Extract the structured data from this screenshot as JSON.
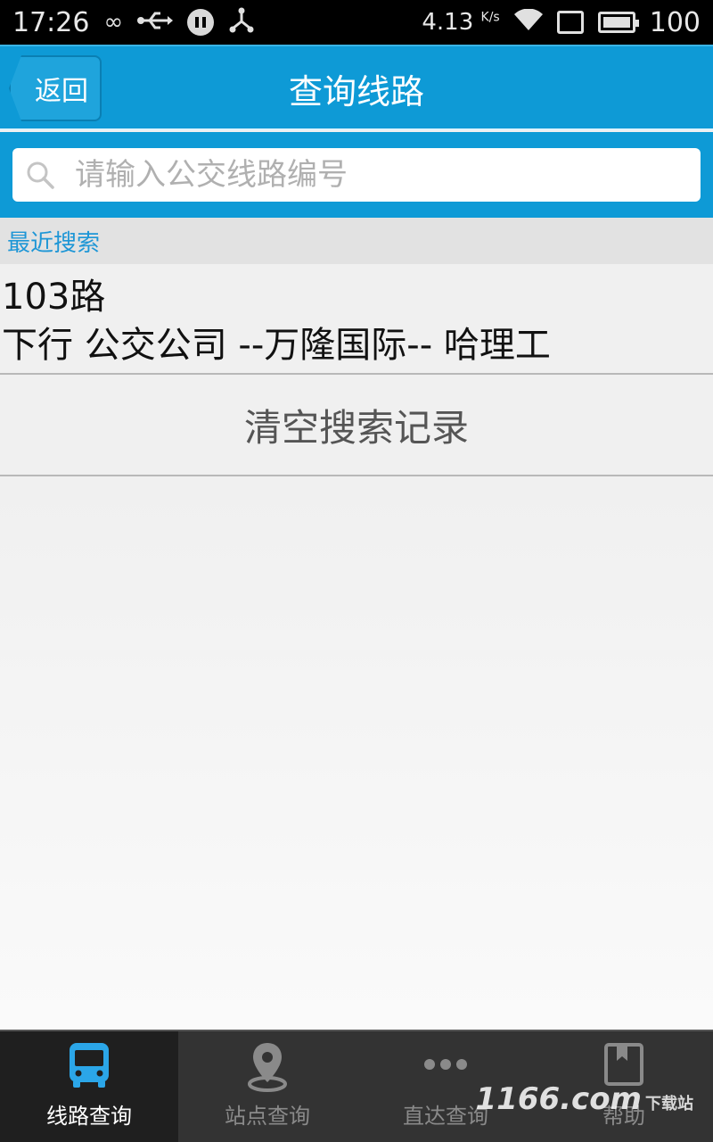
{
  "status_bar": {
    "time": "17:26",
    "speed": "4.13",
    "speed_unit": "K/s",
    "battery": "100"
  },
  "header": {
    "back_label": "返回",
    "title": "查询线路"
  },
  "search": {
    "placeholder": "请输入公交线路编号",
    "value": ""
  },
  "recent": {
    "heading": "最近搜索",
    "items": [
      {
        "route": "103路",
        "detail": "下行 公交公司 --万隆国际-- 哈理工"
      }
    ],
    "clear_label": "清空搜索记录"
  },
  "bottom_nav": {
    "items": [
      {
        "label": "线路查询",
        "icon": "bus-icon",
        "active": true
      },
      {
        "label": "站点查询",
        "icon": "map-pin-icon",
        "active": false
      },
      {
        "label": "直达查询",
        "icon": "more-dots-icon",
        "active": false
      },
      {
        "label": "帮助",
        "icon": "book-icon",
        "active": false
      }
    ]
  },
  "watermark": {
    "text": "1166.com",
    "sub": "下载站"
  },
  "colors": {
    "primary": "#0e9ad6",
    "accent_text": "#1d96d6",
    "nav_bg": "#333333",
    "nav_active_bg": "#1f1f1f"
  }
}
